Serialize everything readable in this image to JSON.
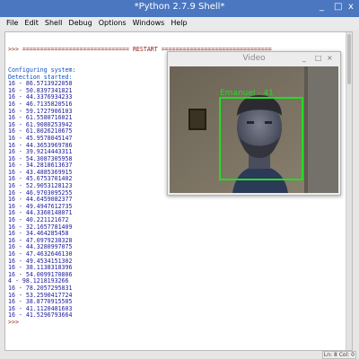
{
  "window": {
    "title": "*Python 2.7.9 Shell*",
    "minimize_glyph": "_",
    "maximize_glyph": "□",
    "close_glyph": "x"
  },
  "menu": [
    "File",
    "Edit",
    "Shell",
    "Debug",
    "Options",
    "Windows",
    "Help"
  ],
  "shell": {
    "restart_line": ">>> ============================== RESTART ===============================",
    "prompt": ">>>",
    "lines": [
      "Configuring system:",
      "Detection started:",
      "16 - 86.5713922058",
      "16 - 50.8397341821",
      "16 - 44.3376934233",
      "16 - 46.7135820516",
      "16 - 59.1727906103",
      "16 - 61.5580716021",
      "16 - 61.9080253942",
      "16 - 61.8026210675",
      "16 - 45.9578045147",
      "16 - 44.3653969786",
      "16 - 39.9214443311",
      "16 - 54.3087305958",
      "16 - 34.2818613637",
      "16 - 43.4885369915",
      "16 - 45.6753701402",
      "16 - 52.9053128123",
      "16 - 46.9703095255",
      "16 - 44.6459082377",
      "16 - 49.4947612735",
      "16 - 44.3360148071",
      "16 - 40.221121672",
      "16 - 32.1657781409",
      "16 - 34.464285458",
      "16 - 47.0979238328",
      "16 - 44.3280997075",
      "16 - 47.4632646130",
      "16 - 49.4534151302",
      "16 - 38.1138318396",
      "16 - 54.0099170806",
      "4 - 98.1218193266",
      "16 - 78.2057295831",
      "16 - 53.2590417724",
      "16 - 38.8770915505",
      "16 - 41.1120481603",
      "16 - 41.5296793664"
    ]
  },
  "status": {
    "text": "Ln: 8 Col: 0"
  },
  "video": {
    "title": "Video",
    "minimize_glyph": "_",
    "maximize_glyph": "□",
    "close_glyph": "×",
    "face_label": "Emanuel - 41"
  },
  "colors": {
    "titlebar": "#4a77c0",
    "prompt": "#8b1a10",
    "output": "#1b1b9a",
    "face_box": "#22dd22"
  }
}
